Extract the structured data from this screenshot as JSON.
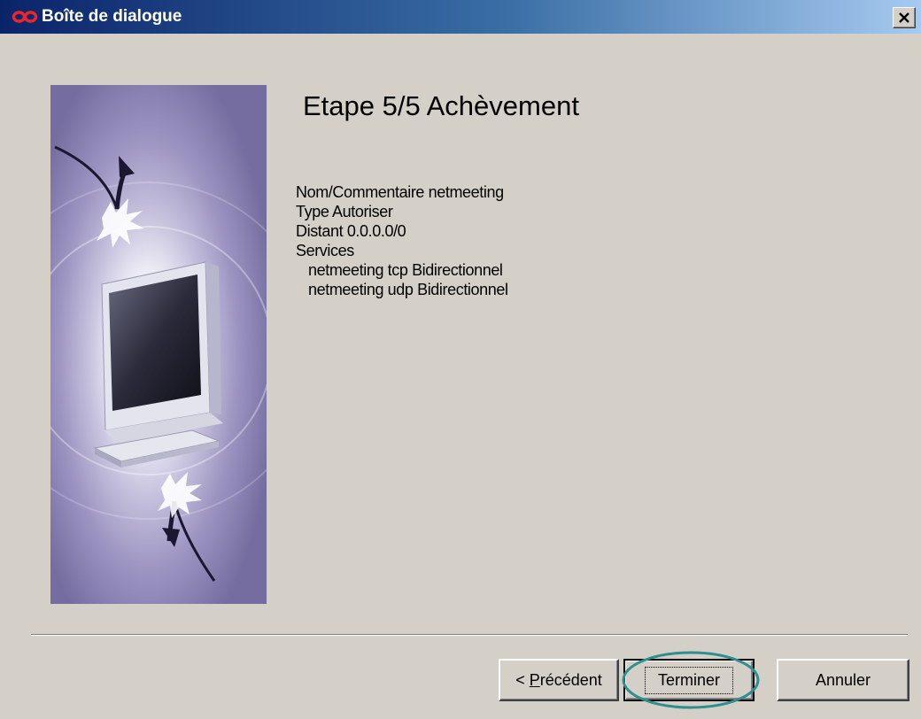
{
  "window": {
    "title": "Boîte de dialogue"
  },
  "wizard": {
    "step_title": "Etape 5/5 Achèvement",
    "summary": {
      "name_line": "Nom/Commentaire netmeeting",
      "type_line": "Type Autoriser",
      "remote_line": "Distant 0.0.0.0/0",
      "services_label": "Services",
      "services": [
        "netmeeting tcp Bidirectionnel",
        "netmeeting udp Bidirectionnel"
      ]
    }
  },
  "buttons": {
    "prev_hotkey": "P",
    "prev_rest": "récédent",
    "finish": "Terminer",
    "cancel": "Annuler"
  },
  "colors": {
    "titlebar_start": "#0a246a",
    "titlebar_end": "#a6caf0",
    "dialog_bg": "#d4d0c8",
    "annotation_circle": "#2f8f8f",
    "logo": "#e8262d"
  },
  "icons": {
    "title_logo": "livebox-infinity-logo",
    "close": "close-x-icon"
  }
}
